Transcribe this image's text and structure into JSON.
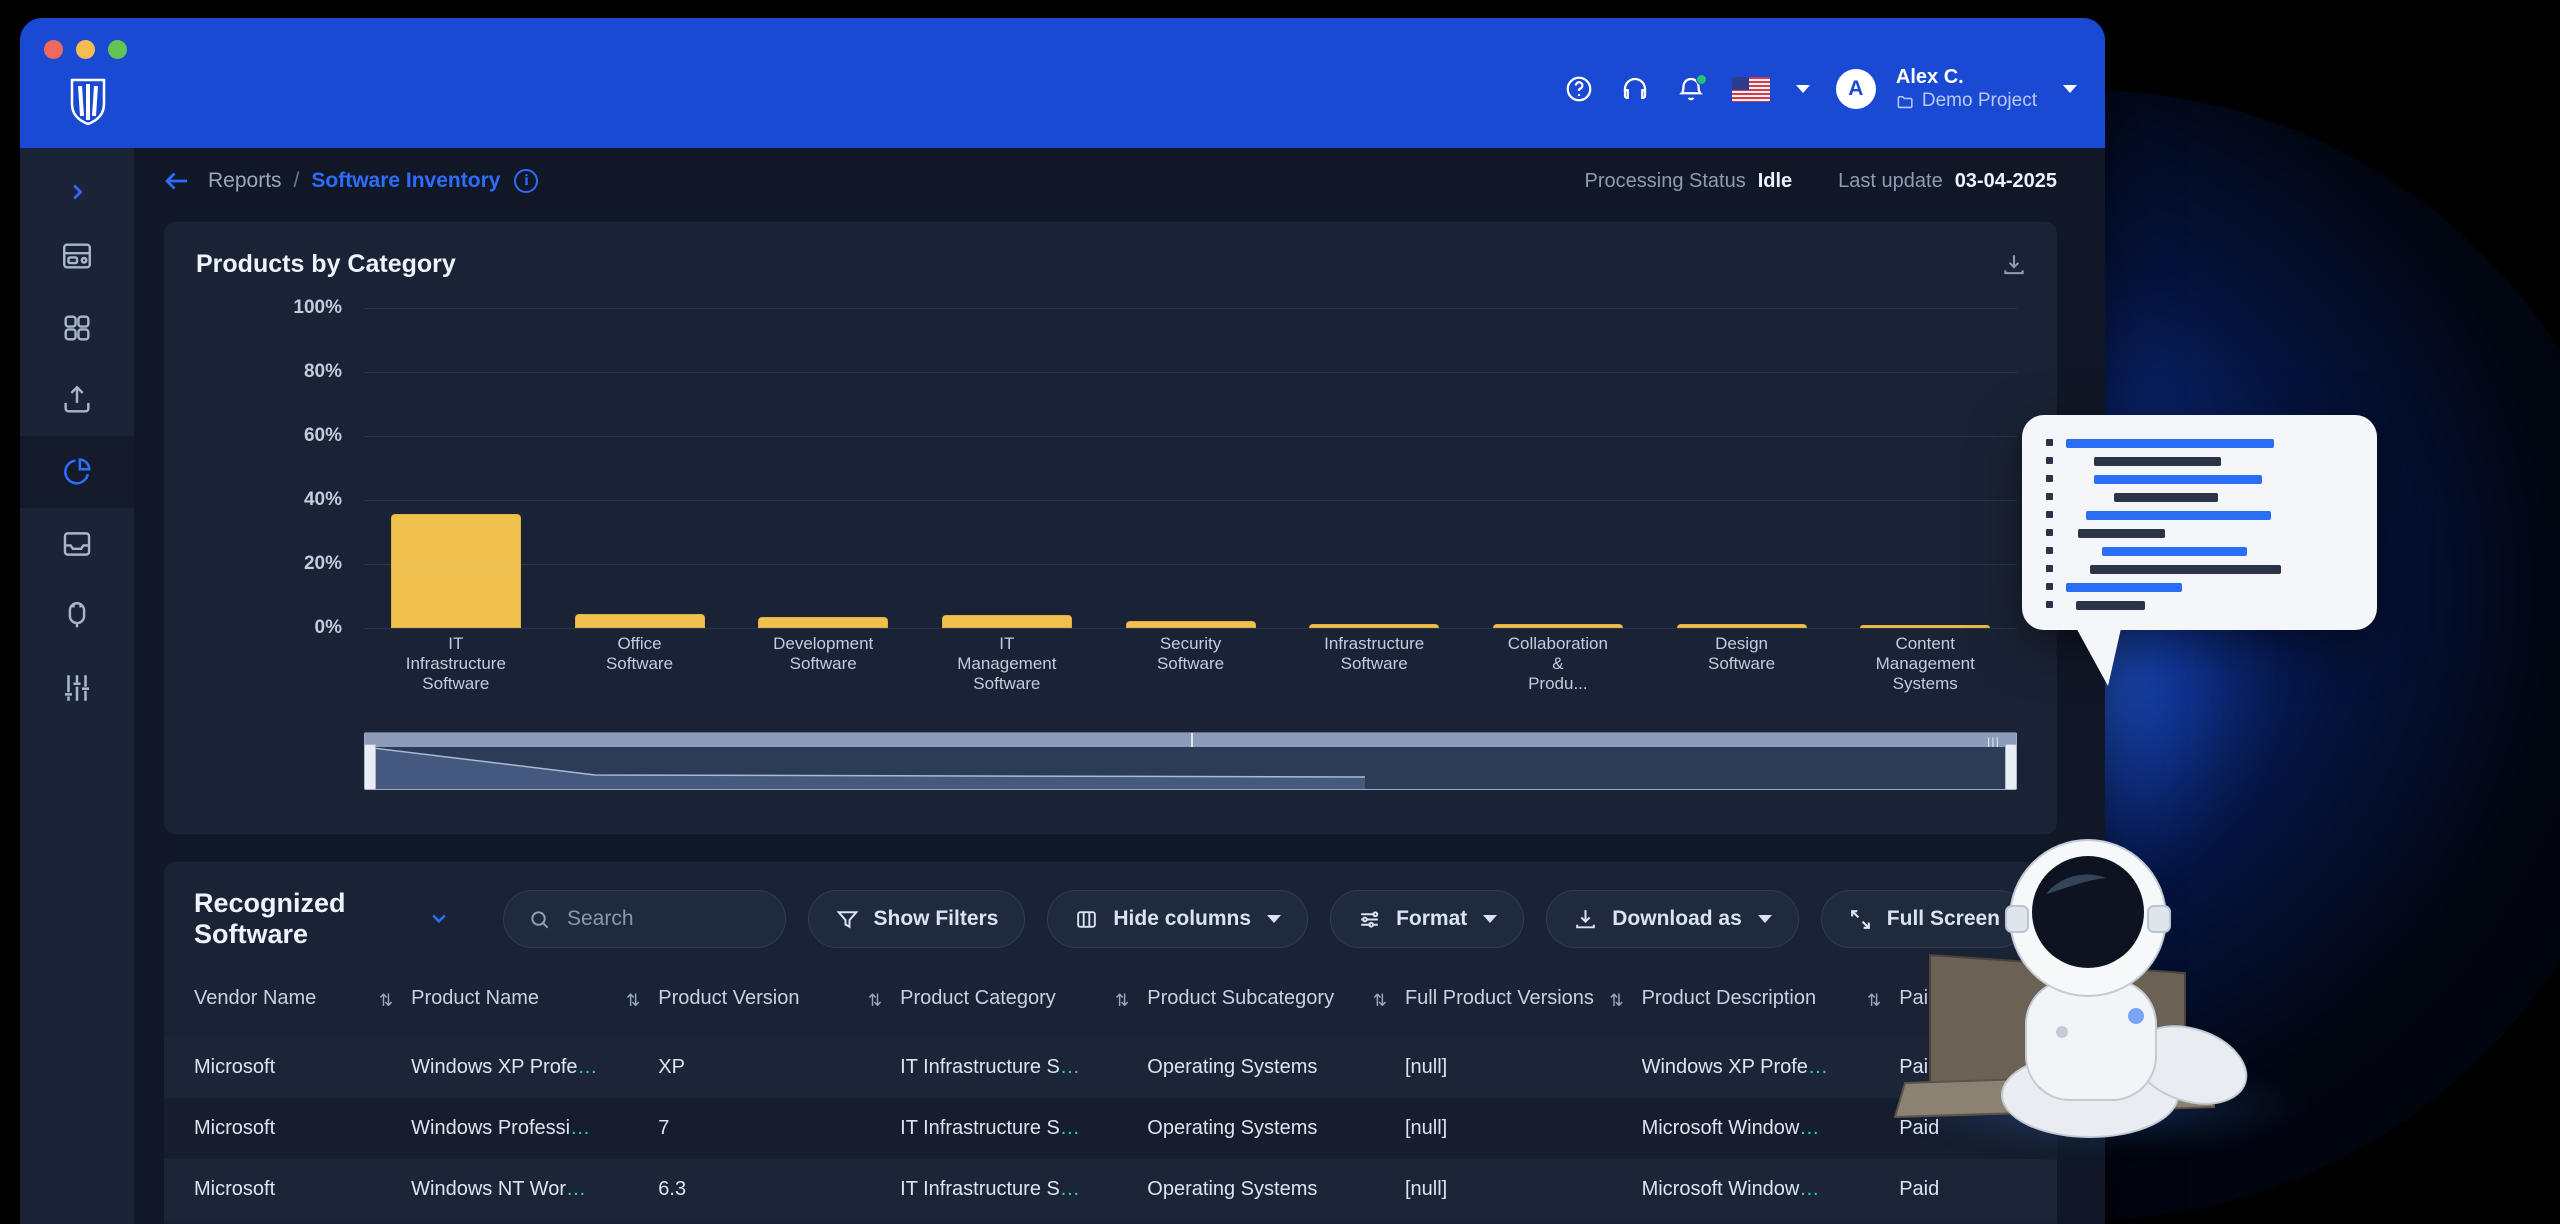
{
  "window": {
    "traffic_lights": [
      "close",
      "minimize",
      "maximize"
    ],
    "brand": "app-logo"
  },
  "header": {
    "icons": [
      "help-circle-icon",
      "headset-icon",
      "bell-icon",
      "flag-us-icon"
    ],
    "language_flag": "US",
    "avatar_initial": "A",
    "user_name": "Alex C.",
    "project_name": "Demo Project"
  },
  "breadcrumb": {
    "back": "←",
    "parent": "Reports",
    "separator": "/",
    "current": "Software Inventory",
    "info": "i"
  },
  "status": {
    "processing_label": "Processing Status",
    "processing_value": "Idle",
    "update_label": "Last update",
    "update_value": "03-04-2025"
  },
  "sidebar": {
    "expand_icon": "chevron-right-icon",
    "items": [
      {
        "name": "dashboard",
        "icon": "layout-dashboard-icon",
        "active": false
      },
      {
        "name": "apps",
        "icon": "grid-apps-icon",
        "active": false
      },
      {
        "name": "upload",
        "icon": "upload-icon",
        "active": false
      },
      {
        "name": "reports",
        "icon": "pie-chart-icon",
        "active": true
      },
      {
        "name": "inbox",
        "icon": "inbox-icon",
        "active": false
      },
      {
        "name": "plugins",
        "icon": "plug-icon",
        "active": false
      },
      {
        "name": "settings",
        "icon": "sliders-icon",
        "active": false
      }
    ]
  },
  "chart_card": {
    "title": "Products by Category",
    "download_icon": "download-icon"
  },
  "chart_data": {
    "type": "bar",
    "title": "Products by Category",
    "xlabel": "",
    "ylabel": "",
    "ylim": [
      0,
      100
    ],
    "yticks": [
      "0%",
      "20%",
      "40%",
      "60%",
      "80%",
      "100%"
    ],
    "grid": true,
    "legend": "none",
    "bar_color": "#f0c04f",
    "categories": [
      "IT Infrastructure Software",
      "Office Software",
      "Development Software",
      "IT Management Software",
      "Security Software",
      "Infrastructure Software",
      "Collaboration & Produ...",
      "Design Software",
      "Content Management Systems"
    ],
    "category_lines": [
      [
        "IT",
        "Infrastructure",
        "Software"
      ],
      [
        "Office",
        "Software"
      ],
      [
        "Development",
        "Software"
      ],
      [
        "IT",
        "Management",
        "Software"
      ],
      [
        "Security",
        "Software"
      ],
      [
        "Infrastructure",
        "Software"
      ],
      [
        "Collaboration",
        "&",
        "Produ..."
      ],
      [
        "Design",
        "Software"
      ],
      [
        "Content",
        "Management",
        "Systems"
      ]
    ],
    "values": [
      35.5,
      4.5,
      3.5,
      4.2,
      2.3,
      1.3,
      1.2,
      1.1,
      0.7
    ]
  },
  "table_section": {
    "title": "Recognized Software",
    "title_caret": "chevron-down-icon",
    "search_placeholder": "Search",
    "search_value": "",
    "buttons": [
      {
        "name": "show-filters",
        "label": "Show Filters",
        "icon": "filter-icon",
        "caret": false
      },
      {
        "name": "hide-columns",
        "label": "Hide columns",
        "icon": "columns-icon",
        "caret": true
      },
      {
        "name": "format",
        "label": "Format",
        "icon": "sliders-icon",
        "caret": true
      },
      {
        "name": "download-as",
        "label": "Download as",
        "icon": "download-icon",
        "caret": true
      },
      {
        "name": "full-screen",
        "label": "Full Screen",
        "icon": "expand-icon",
        "caret": false
      }
    ],
    "columns": [
      {
        "label": "Vendor Name",
        "sortable": true
      },
      {
        "label": "Product Name",
        "sortable": true
      },
      {
        "label": "Product Version",
        "sortable": true
      },
      {
        "label": "Product Category",
        "sortable": true
      },
      {
        "label": "Product Subcategory",
        "sortable": true
      },
      {
        "label": "Full Product Versions",
        "sortable": true
      },
      {
        "label": "Product Description",
        "sortable": true
      },
      {
        "label": "Paid",
        "sortable": false
      }
    ],
    "rows": [
      {
        "vendor": "Microsoft",
        "product": "Windows XP Profe…",
        "version": "XP",
        "category": "IT Infrastructure S…",
        "subcategory": "Operating Systems",
        "full_versions": "[null]",
        "description": "Windows XP Profe…",
        "paid": "Paid"
      },
      {
        "vendor": "Microsoft",
        "product": "Windows Professi…",
        "version": "7",
        "category": "IT Infrastructure S…",
        "subcategory": "Operating Systems",
        "full_versions": "[null]",
        "description": "Microsoft Window…",
        "paid": "Paid"
      },
      {
        "vendor": "Microsoft",
        "product": "Windows NT Wor…",
        "version": "6.3",
        "category": "IT Infrastructure S…",
        "subcategory": "Operating Systems",
        "full_versions": "[null]",
        "description": "Microsoft Window…",
        "paid": "Paid"
      }
    ]
  },
  "colors": {
    "brand_blue": "#1a4ad4",
    "accent_blue": "#2e6bff",
    "bar_yellow": "#f0c04f",
    "panel": "#1a2336",
    "background": "#101827",
    "ellipsis_teal": "#2fd3c6"
  }
}
